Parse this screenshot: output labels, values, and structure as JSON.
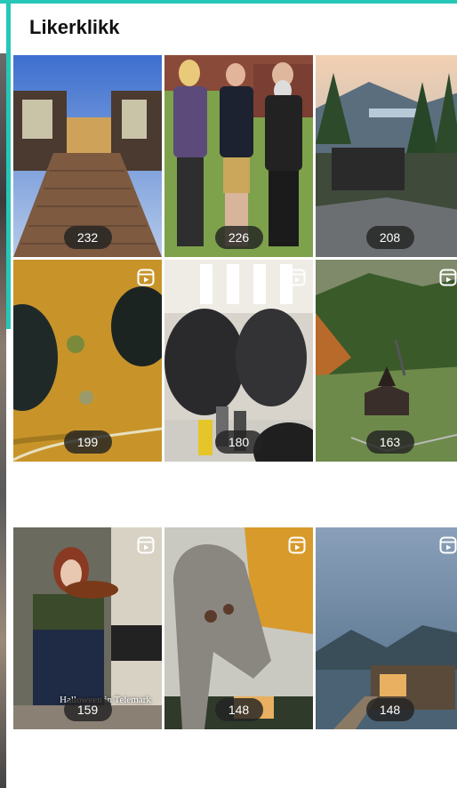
{
  "section": {
    "title": "Likerklikk"
  },
  "tiles": [
    {
      "likes": "232",
      "is_reel": false,
      "icon": ""
    },
    {
      "likes": "226",
      "is_reel": false,
      "icon": ""
    },
    {
      "likes": "208",
      "is_reel": false,
      "icon": ""
    },
    {
      "likes": "199",
      "is_reel": true,
      "icon": "reel-icon"
    },
    {
      "likes": "180",
      "is_reel": true,
      "icon": "reel-icon"
    },
    {
      "likes": "163",
      "is_reel": true,
      "icon": "reel-icon"
    },
    {
      "likes": "159",
      "is_reel": true,
      "icon": "reel-icon",
      "caption": "Halloween in Telemark"
    },
    {
      "likes": "148",
      "is_reel": true,
      "icon": "reel-icon"
    },
    {
      "likes": "148",
      "is_reel": true,
      "icon": "reel-icon"
    }
  ],
  "colors": {
    "accent": "#27c7b8",
    "badge_bg": "#232323"
  }
}
